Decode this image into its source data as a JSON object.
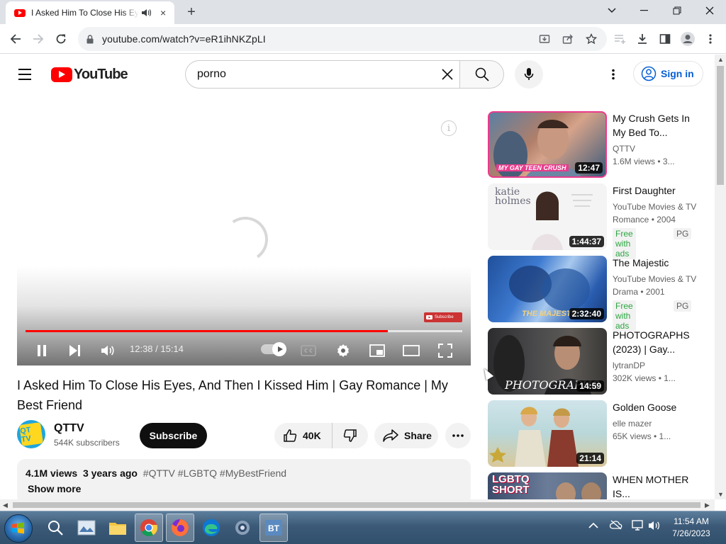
{
  "browser": {
    "tab": {
      "title": "I Asked Him To Close His Eyes, And Then I Kissed Him | Gay Romance | My Best Friend",
      "close_icon": "×"
    },
    "new_tab_icon": "+",
    "window_controls": {
      "dropdown": "⌄",
      "minimize": "—",
      "restore": "❐",
      "close": "✕"
    },
    "url": "youtube.com/watch?v=eR1ihNKZpLI"
  },
  "masthead": {
    "logo_text": "YouTube",
    "search_value": "porno",
    "signin_label": "Sign in"
  },
  "player": {
    "current_time": "12:38",
    "duration": "15:14",
    "time_display": "12:38 / 15:14",
    "progress_fraction": 0.83,
    "info_icon": "i",
    "watermark_label": "Subscribe"
  },
  "video": {
    "title": "I Asked Him To Close His Eyes, And Then I Kissed Him | Gay Romance | My Best Friend",
    "channel": {
      "name": "QTTV",
      "subscribers": "544K subscribers",
      "avatar_text": "QT TV"
    },
    "subscribe_label": "Subscribe",
    "likes": "40K",
    "share_label": "Share",
    "description": {
      "views": "4.1M views",
      "age": "3 years ago",
      "tags": "#QTTV #LGBTQ #MyBestFriend",
      "show_more": "Show more"
    }
  },
  "recommendations": [
    {
      "title": "My Crush Gets In My Bed To...",
      "channel": "QTTV",
      "meta": "1.6M views • 3...",
      "duration": "12:47",
      "thumb_caption": "MY GAY TEEN CRUSH"
    },
    {
      "title": "First Daughter",
      "channel": "YouTube Movies & TV",
      "meta": "Romance • 2004",
      "duration": "1:44:37",
      "badge": "Free with ads",
      "rating": "PG",
      "thumb_caption": "katie holmes"
    },
    {
      "title": "The Majestic",
      "channel": "YouTube Movies & TV",
      "meta": "Drama • 2001",
      "duration": "2:32:40",
      "badge": "Free with ads",
      "rating": "PG",
      "thumb_caption": "THE MAJESTIC"
    },
    {
      "title": "PHOTOGRAPHS (2023) | Gay...",
      "channel": "lytranDP",
      "meta": "302K views • 1...",
      "duration": "14:59",
      "thumb_caption": "PHOTOGRAPHS"
    },
    {
      "title": "Golden Goose",
      "channel": "elle mazer",
      "meta": "65K views • 1...",
      "duration": "21:14"
    },
    {
      "title": "WHEN MOTHER IS...",
      "thumb_caption": "LGBTQ SHORT"
    }
  ],
  "taskbar": {
    "clock_time": "11:54 AM",
    "clock_date": "7/26/2023"
  },
  "colors": {
    "youtube_red": "#ff0000",
    "link_blue": "#065fd4",
    "free_green": "#2ba640"
  }
}
